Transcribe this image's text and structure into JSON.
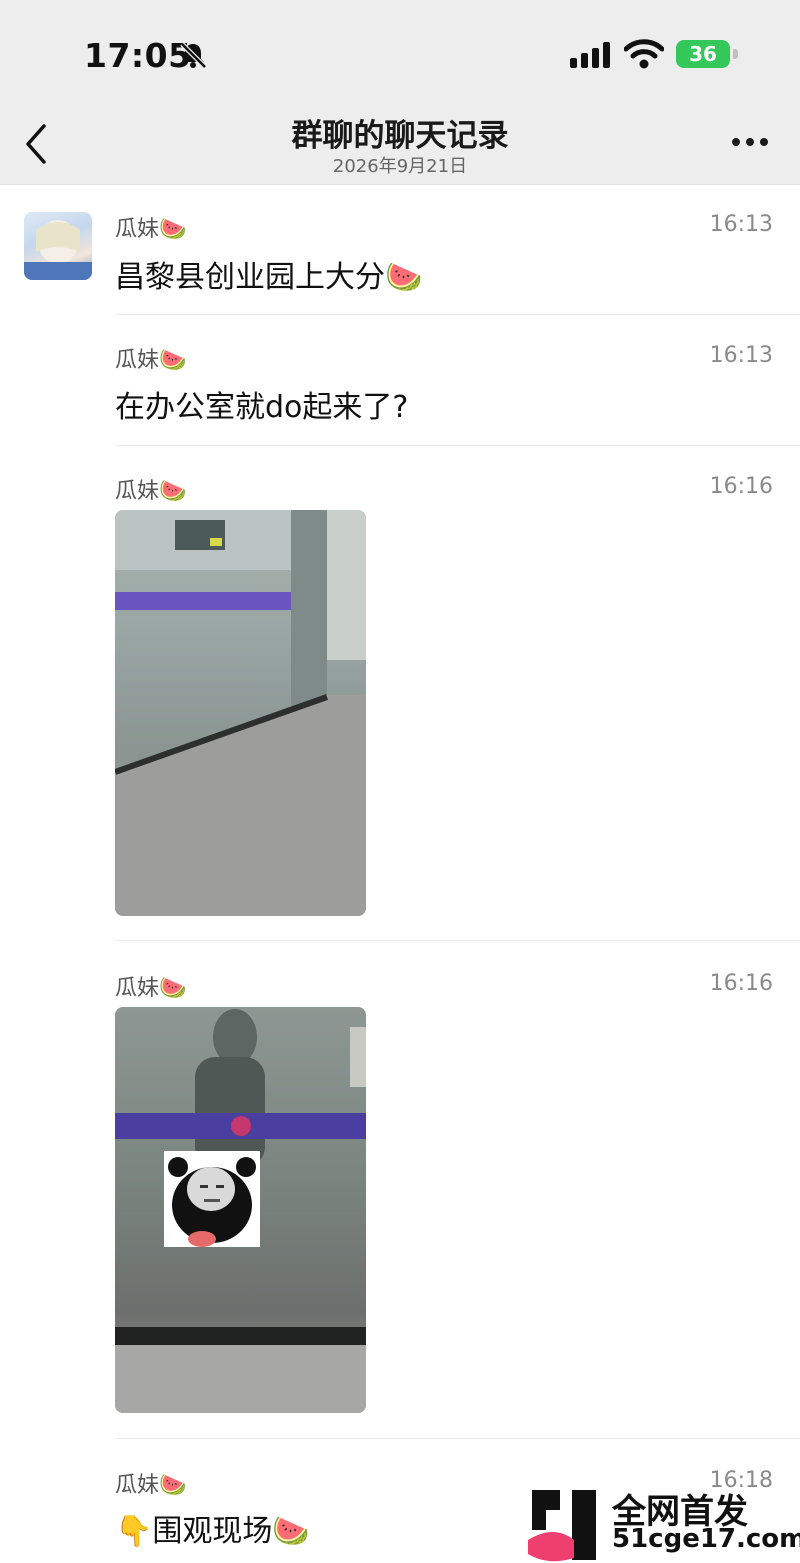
{
  "status": {
    "time": "17:05",
    "battery": "36"
  },
  "nav": {
    "title": "群聊的聊天记录",
    "date": "2026年9月21日"
  },
  "messages": [
    {
      "name": "瓜妹🍉",
      "time": "16:13",
      "text": "昌黎县创业园上大分🍉"
    },
    {
      "name": "瓜妹🍉",
      "time": "16:13",
      "text": "在办公室就do起来了?"
    },
    {
      "name": "瓜妹🍉",
      "time": "16:16"
    },
    {
      "name": "瓜妹🍉",
      "time": "16:16"
    },
    {
      "name": "瓜妹🍉",
      "time": "16:18",
      "text": "👇围观现场🍉"
    }
  ],
  "watermark": {
    "title": "全网首发",
    "url": "51cge17.com"
  },
  "colors": {
    "header_bg": "#ededed",
    "battery": "#34c759",
    "accent_stripe": "#5b4bb0"
  },
  "icons": [
    "back-chevron-icon",
    "bell-slash-icon",
    "signal-icon",
    "wifi-icon",
    "battery-icon",
    "more-icon"
  ]
}
